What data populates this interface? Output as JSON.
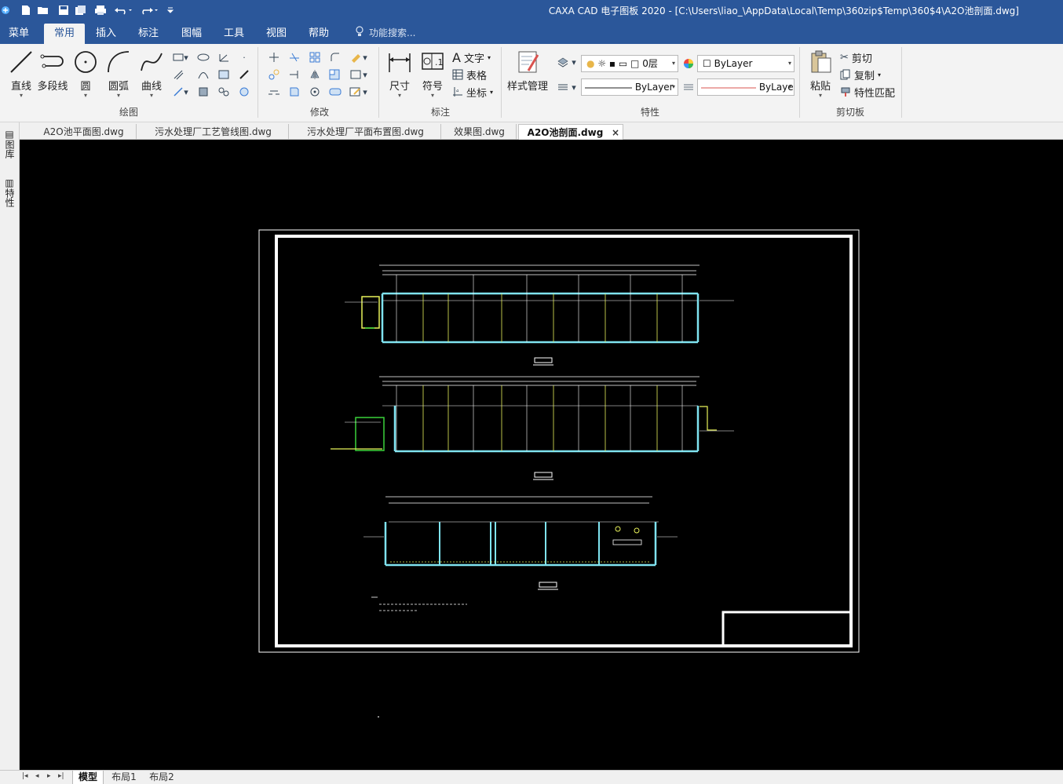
{
  "window": {
    "title": "CAXA CAD 电子图板 2020 - [C:\\Users\\liao_\\AppData\\Local\\Temp\\360zip$Temp\\360$4\\A2O池剖面.dwg]"
  },
  "quick_access": [
    {
      "name": "new",
      "icon": "new-file-icon"
    },
    {
      "name": "open",
      "icon": "open-folder-icon"
    },
    {
      "name": "save",
      "icon": "save-icon"
    },
    {
      "name": "save-all",
      "icon": "save-all-icon"
    },
    {
      "name": "print",
      "icon": "print-icon"
    },
    {
      "name": "undo",
      "icon": "undo-icon"
    },
    {
      "name": "redo",
      "icon": "redo-icon"
    }
  ],
  "menubar": {
    "items": [
      "菜单",
      "常用",
      "插入",
      "标注",
      "图幅",
      "工具",
      "视图",
      "帮助"
    ],
    "active": "常用",
    "search_placeholder": "功能搜索..."
  },
  "ribbon": {
    "groups": {
      "draw": "绘图",
      "modify": "修改",
      "annotate": "标注",
      "properties": "特性",
      "clipboard": "剪切板"
    },
    "draw_tools": [
      "直线",
      "多段线",
      "圆",
      "圆弧",
      "曲线"
    ],
    "annotate_tools": {
      "dimension": "尺寸",
      "symbol": "符号",
      "text": "文字",
      "table": "表格",
      "coordinate": "坐标"
    },
    "properties": {
      "style_manager": "样式管理",
      "layer": "0层",
      "color": "ByLayer",
      "linetype": "ByLayer",
      "lineweight": "ByLayer"
    },
    "clipboard": {
      "paste": "粘贴",
      "cut": "剪切",
      "copy": "复制",
      "match_props": "特性匹配"
    }
  },
  "tabs": [
    {
      "label": "A2O池平面图.dwg",
      "active": false
    },
    {
      "label": "污水处理厂工艺管线图.dwg",
      "active": false
    },
    {
      "label": "污水处理厂平面布置图.dwg",
      "active": false
    },
    {
      "label": "效果图.dwg",
      "active": false
    },
    {
      "label": "A2O池剖面.dwg",
      "active": true
    }
  ],
  "side_panel": [
    "图库",
    "特性"
  ],
  "layout_tabs": [
    "模型",
    "布局1",
    "布局2"
  ],
  "active_layout": "模型",
  "drawing_colors": {
    "border": "#ffffff",
    "wall": "#7fe3f0",
    "pipe": "#e8f25a",
    "green": "#3ad23a"
  }
}
